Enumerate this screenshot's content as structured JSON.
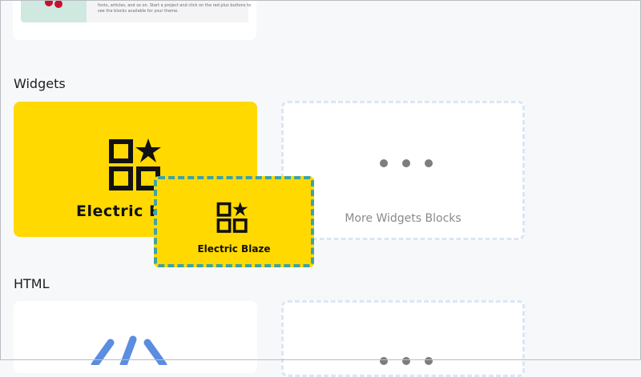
{
  "top_card": {
    "description": "fonts, articles, and so on. Start a project and click on the red plus buttons to see the blocks available for your theme."
  },
  "sections": {
    "widgets": {
      "title": "Widgets",
      "block_name": "Electric Blaze",
      "more_label": "More Widgets Blocks"
    },
    "html": {
      "title": "HTML"
    }
  },
  "drag_ghost": {
    "label": "Electric Blaze"
  },
  "colors": {
    "block_yellow": "#ffd900",
    "ghost_border": "#3ea3a3",
    "placeholder_border": "#dbe6f6",
    "code_icon": "#5b8de0"
  },
  "icons": [
    "blocks-star-icon",
    "more-dots-icon",
    "code-icon"
  ]
}
